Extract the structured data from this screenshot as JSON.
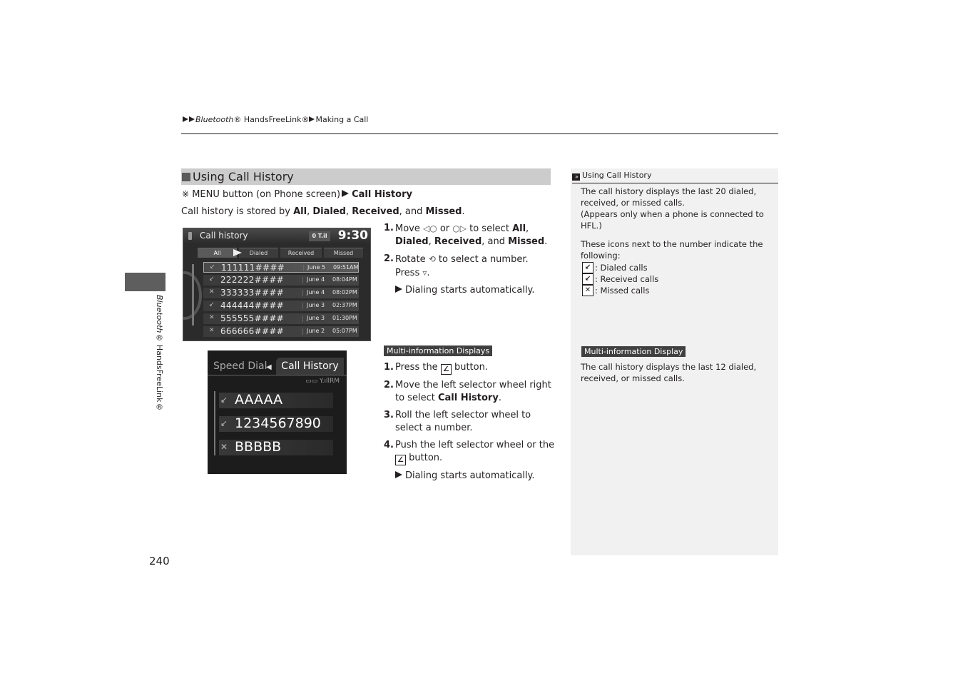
{
  "breadcrumb": {
    "items": [
      "Bluetooth",
      "® HandsFreeLink®",
      "Making a Call"
    ]
  },
  "side_tab": {
    "label_italic": "Bluetooth",
    "label_rest": "® HandsFreeLink®"
  },
  "page_number": "240",
  "section": {
    "title": "Using Call History",
    "path_prefix": "MENU button (on Phone screen)",
    "path_target": "Call History",
    "stored_prefix": "Call history is stored by ",
    "stored_all": "All",
    "stored_dialed": "Dialed",
    "stored_received": "Received",
    "stored_and": ", and ",
    "stored_missed": "Missed",
    "icons": {
      "menu": "menu-button-icon"
    }
  },
  "nav_screen": {
    "title": "Call history",
    "status": "0 T.il",
    "clock": "9:30",
    "tabs": [
      "All",
      "Dialed",
      "Received",
      "Missed"
    ],
    "active_tab": "All",
    "rows": [
      {
        "icon": "dialed-call-icon",
        "number": "111111####",
        "date": "June 5",
        "time": "09:51AM",
        "selected": true
      },
      {
        "icon": "received-call-icon",
        "number": "222222####",
        "date": "June 4",
        "time": "08:04PM",
        "selected": false
      },
      {
        "icon": "missed-call-icon",
        "number": "333333####",
        "date": "June 4",
        "time": "08:02PM",
        "selected": false
      },
      {
        "icon": "dialed-call-icon",
        "number": "444444####",
        "date": "June 3",
        "time": "02:37PM",
        "selected": false
      },
      {
        "icon": "missed-call-icon",
        "number": "555555####",
        "date": "June 3",
        "time": "01:30PM",
        "selected": false
      },
      {
        "icon": "missed-call-icon",
        "number": "666666####",
        "date": "June 2",
        "time": "05:07PM",
        "selected": false
      }
    ]
  },
  "nav_steps": {
    "s1_num": "1.",
    "s1_a": "Move ",
    "s1_b": " or ",
    "s1_c": " to select ",
    "s1_all": "All",
    "s1_comma": ",",
    "s1_dialed": "Dialed",
    "s1_received": "Received",
    "s1_and": ", and ",
    "s1_missed": "Missed",
    "s2_num": "2.",
    "s2_a": "Rotate ",
    "s2_b": " to select a number.",
    "s2_press": "Press ",
    "result": "Dialing starts automatically."
  },
  "mid_screen": {
    "tab_inactive": "Speed Dial",
    "tab_active": "Call History",
    "signal": "▭▭ Y.ıllRM",
    "rows": [
      {
        "icon": "received-call-icon",
        "label": "AAAAA"
      },
      {
        "icon": "received-call-icon",
        "label": "1234567890"
      },
      {
        "icon": "missed-call-icon",
        "label": "BBBBB"
      }
    ]
  },
  "mid_steps": {
    "tag": "Multi-information Displays",
    "s1_num": "1.",
    "s1_a": "Press the ",
    "s1_b": " button.",
    "s2_num": "2.",
    "s2_a": "Move the left selector wheel right to select ",
    "s2_bold": "Call History",
    "s2_end": ".",
    "s3_num": "3.",
    "s3": "Roll the left selector wheel to select a number.",
    "s4_num": "4.",
    "s4_a": "Push the left selector wheel or the ",
    "s4_b": " button.",
    "result": "Dialing starts automatically."
  },
  "sidebar": {
    "heading": "Using Call History",
    "p1": "The call history displays the last 20 dialed, received, or missed calls.",
    "p2": "(Appears only when a phone is connected to HFL.)",
    "p3": "These icons next to the number indicate the following:",
    "legend": [
      {
        "icon": "dialed-call-icon",
        "glyph": "↙",
        "label": ": Dialed calls"
      },
      {
        "icon": "received-call-icon",
        "glyph": "↙",
        "label": ": Received calls"
      },
      {
        "icon": "missed-call-icon",
        "glyph": "✕",
        "label": ": Missed calls"
      }
    ],
    "tag": "Multi-information Display",
    "p4": "The call history displays the last 12 dialed, received, or missed calls."
  },
  "colors": {
    "heading_bg": "#cccccc",
    "sidebar_bg": "#f1f1f1",
    "tag_bg": "#404040",
    "side_tab_bg": "#5e5e5e"
  }
}
